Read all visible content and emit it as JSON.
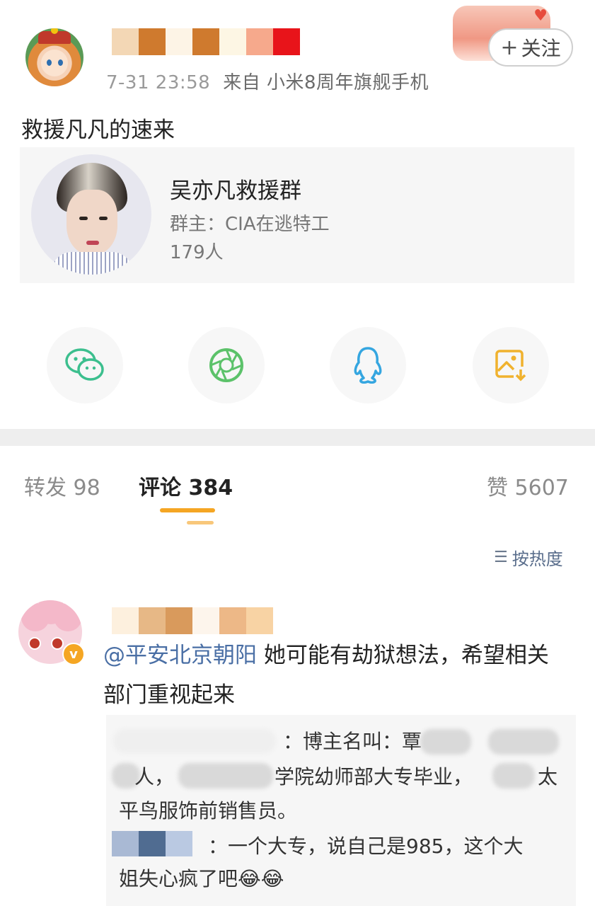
{
  "post": {
    "time": "7-31 23:58",
    "source": "来自 小米8周年旗舰手机",
    "follow_label": "关注",
    "text": "救援凡凡的速来",
    "username_mosaic_colors": [
      "#f3d7b5",
      "#cf7a2e",
      "#fdf4e6",
      "#cf7a2e",
      "#fdf6e4",
      "#f6a98c",
      "#e8141a"
    ]
  },
  "group_card": {
    "name": "吴亦凡救援群",
    "owner": "群主：CIA在逃特工",
    "members": "179人"
  },
  "share": [
    "wechat-icon",
    "moments-icon",
    "qq-icon",
    "save-image-icon"
  ],
  "tabs": {
    "repost": "转发 98",
    "comment": "评论 384",
    "like": "赞 5607"
  },
  "sort_label": "按热度",
  "comment": {
    "name_mosaic_colors": [
      "#fdf0de",
      "#e7b886",
      "#d99a5c",
      "#fdf5ec",
      "#edb887",
      "#f8d3a4"
    ],
    "mention": "@平安北京朝阳",
    "text": " 她可能有劫狱想法，希望相关部门重视起来",
    "quote": {
      "line1": "：博主名叫：覃",
      "line2a": "人，",
      "line2b": "学院幼师部大专毕业，",
      "line2c": "太",
      "line3": "平鸟服饰前销售员。",
      "line4": "：一个大专，说自己是985，这个大",
      "line5": "姐失心疯了吧😂😂",
      "mosaic_colors": [
        "#a9b9d4",
        "#506c91",
        "#bac9e2"
      ]
    }
  },
  "colors": {
    "accent": "#f5a623",
    "mention": "#4a6fa5",
    "wechat": "#3cbf8e",
    "moments": "#5cc26a",
    "qq": "#35a6e0",
    "save": "#f0b22e"
  }
}
